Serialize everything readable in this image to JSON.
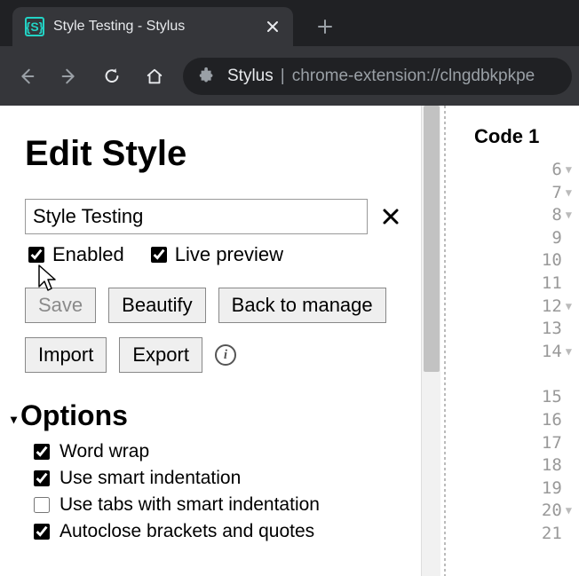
{
  "browser": {
    "tab_title": "Style Testing - Stylus",
    "address_prefix": "Stylus",
    "address_rest": "chrome-extension://clngdbkpkpe"
  },
  "page": {
    "title": "Edit Style",
    "style_name": "Style Testing",
    "enabled_label": "Enabled",
    "live_preview_label": "Live preview",
    "buttons": {
      "save": "Save",
      "beautify": "Beautify",
      "back": "Back to manage",
      "import": "Import",
      "export": "Export"
    },
    "options_title": "Options",
    "options": [
      {
        "label": "Word wrap",
        "checked": true
      },
      {
        "label": "Use smart indentation",
        "checked": true
      },
      {
        "label": "Use tabs with smart indentation",
        "checked": false
      },
      {
        "label": "Autoclose brackets and quotes",
        "checked": true
      }
    ]
  },
  "code": {
    "header": "Code 1",
    "lines": [
      {
        "n": 6,
        "fold": true
      },
      {
        "n": 7,
        "fold": true
      },
      {
        "n": 8,
        "fold": true
      },
      {
        "n": 9,
        "fold": false
      },
      {
        "n": 10,
        "fold": false
      },
      {
        "n": 11,
        "fold": false
      },
      {
        "n": 12,
        "fold": true
      },
      {
        "n": 13,
        "fold": false
      },
      {
        "n": 14,
        "fold": true
      },
      {
        "gap": true
      },
      {
        "n": 15,
        "fold": false
      },
      {
        "n": 16,
        "fold": false
      },
      {
        "n": 17,
        "fold": false
      },
      {
        "n": 18,
        "fold": false
      },
      {
        "n": 19,
        "fold": false
      },
      {
        "n": 20,
        "fold": true
      },
      {
        "n": 21,
        "fold": false
      }
    ]
  }
}
